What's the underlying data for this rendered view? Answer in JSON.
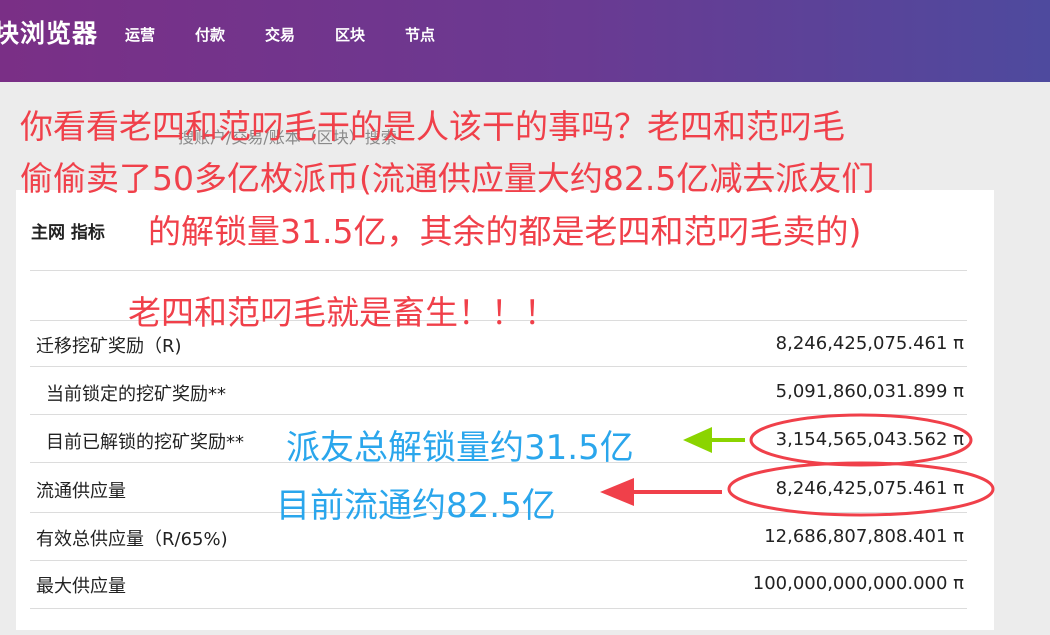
{
  "header": {
    "brand": "块浏览器",
    "nav": [
      "运营",
      "付款",
      "交易",
      "区块",
      "节点"
    ]
  },
  "search": {
    "placeholder": "搜账户/交易/账本（区块）搜索"
  },
  "panel": {
    "title": "主网 指标",
    "rows": [
      {
        "label": "迁移挖矿奖励（R)",
        "value": "8,246,425,075.461 π"
      },
      {
        "label": "当前锁定的挖矿奖励**",
        "value": "5,091,860,031.899 π"
      },
      {
        "label": "目前已解锁的挖矿奖励**",
        "value": "3,154,565,043.562 π"
      },
      {
        "label": "流通供应量",
        "value": "8,246,425,075.461 π"
      },
      {
        "label": "有效总供应量（R/65%)",
        "value": "12,686,807,808.401 π"
      },
      {
        "label": "最大供应量",
        "value": "100,000,000,000.000 π"
      }
    ]
  },
  "annotations": {
    "red_lines": [
      "你看看老四和范叼毛干的是人该干的事吗？老四和范叼毛",
      "偷偷卖了50多亿枚派币(流通供应量大约82.5亿减去派友们",
      "的解锁量31.5亿，其余的都是老四和范叼毛卖的)"
    ],
    "red_exclaim": "老四和范叼毛就是畜生！！！",
    "blue_unlock": "派友总解锁量约31.5亿",
    "blue_circulation": "目前流通约82.5亿",
    "colors": {
      "red": "#f0404a",
      "blue": "#2aa6ec",
      "green_arrow": "#8bd400"
    }
  }
}
